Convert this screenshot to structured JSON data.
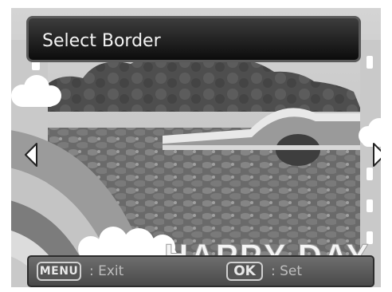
{
  "title": "Select Border",
  "frame_caption": "HAPPY DAY",
  "footer": {
    "menu_key": "MENU",
    "menu_action": ": Exit",
    "ok_key": "OK",
    "ok_action": ": Set"
  },
  "navigation": {
    "left_arrow_icon": "triangle-left-outline",
    "right_arrow_icon": "triangle-right-outline"
  },
  "colors": {
    "title_bar": "#111111",
    "footer_bar": "#555555",
    "text": "#f2f2f2"
  }
}
